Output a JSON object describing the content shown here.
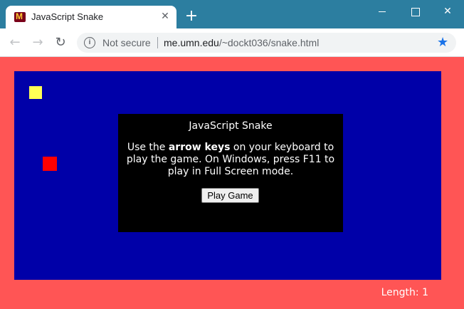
{
  "browser": {
    "tab": {
      "title": "JavaScript Snake",
      "favicon": "umn-m-icon"
    },
    "new_tab_label": "+",
    "window_controls": {
      "minimize": "minimize-icon",
      "maximize": "maximize-icon",
      "close": "✕"
    },
    "nav": {
      "back": "←",
      "forward": "→",
      "reload": "↻"
    },
    "omnibox": {
      "security_label": "Not secure",
      "url_host": "me.umn.edu",
      "url_path": "/~dockt036/snake.html"
    },
    "bookmark_star": "★"
  },
  "game": {
    "colors": {
      "page": "#ff5555",
      "board": "#0000a8",
      "food": "#ffff55",
      "snake": "#ff0000",
      "dialog": "#000000"
    },
    "dialog": {
      "title": "JavaScript Snake",
      "body_prefix": "Use the ",
      "body_bold": "arrow keys",
      "body_suffix": " on your keyboard to play the game. On Windows, press F11 to play in Full Screen mode.",
      "play_button": "Play Game"
    },
    "length_label": "Length: 1"
  }
}
